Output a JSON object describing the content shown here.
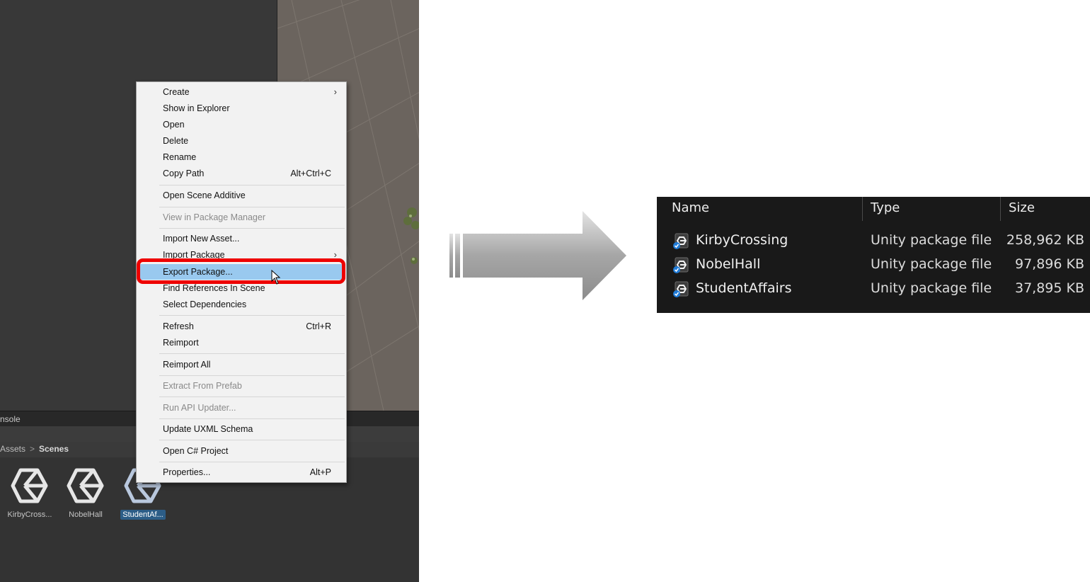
{
  "unity": {
    "console_tab": "nsole",
    "breadcrumb": {
      "root": "Assets",
      "separator": ">",
      "current": "Scenes"
    },
    "assets": [
      {
        "label": "KirbyCross...",
        "selected": false
      },
      {
        "label": "NobelHall",
        "selected": false
      },
      {
        "label": "StudentAf...",
        "selected": true
      }
    ]
  },
  "context_menu": {
    "items": [
      {
        "label": "Create",
        "submenu": true
      },
      {
        "label": "Show in Explorer"
      },
      {
        "label": "Open"
      },
      {
        "label": "Delete"
      },
      {
        "label": "Rename"
      },
      {
        "label": "Copy Path",
        "shortcut": "Alt+Ctrl+C"
      },
      {
        "label": "Open Scene Additive"
      },
      {
        "label": "View in Package Manager",
        "disabled": true
      },
      {
        "label": "Import New Asset..."
      },
      {
        "label": "Import Package",
        "submenu": true
      },
      {
        "label": "Export Package...",
        "highlighted": true
      },
      {
        "label": "Find References In Scene"
      },
      {
        "label": "Select Dependencies"
      },
      {
        "label": "Refresh",
        "shortcut": "Ctrl+R"
      },
      {
        "label": "Reimport"
      },
      {
        "label": "Reimport All"
      },
      {
        "label": "Extract From Prefab",
        "disabled": true
      },
      {
        "label": "Run API Updater...",
        "disabled": true
      },
      {
        "label": "Update UXML Schema"
      },
      {
        "label": "Open C# Project"
      },
      {
        "label": "Properties...",
        "shortcut": "Alt+P"
      }
    ],
    "submenu_arrow": "›",
    "highlight_color": "#99c9ef",
    "callout_color": "#ee0000"
  },
  "explorer": {
    "columns": {
      "name": "Name",
      "type": "Type",
      "size": "Size"
    },
    "files": [
      {
        "name": "KirbyCrossing",
        "type": "Unity package file",
        "size": "258,962 KB"
      },
      {
        "name": "NobelHall",
        "type": "Unity package file",
        "size": "97,896 KB"
      },
      {
        "name": "StudentAffairs",
        "type": "Unity package file",
        "size": "37,895 KB"
      }
    ]
  },
  "icons": {
    "unity_scene": "unity-logo-icon",
    "package_file": "unity-package-icon",
    "cursor": "mouse-pointer-icon",
    "transition": "right-arrow-icon"
  }
}
